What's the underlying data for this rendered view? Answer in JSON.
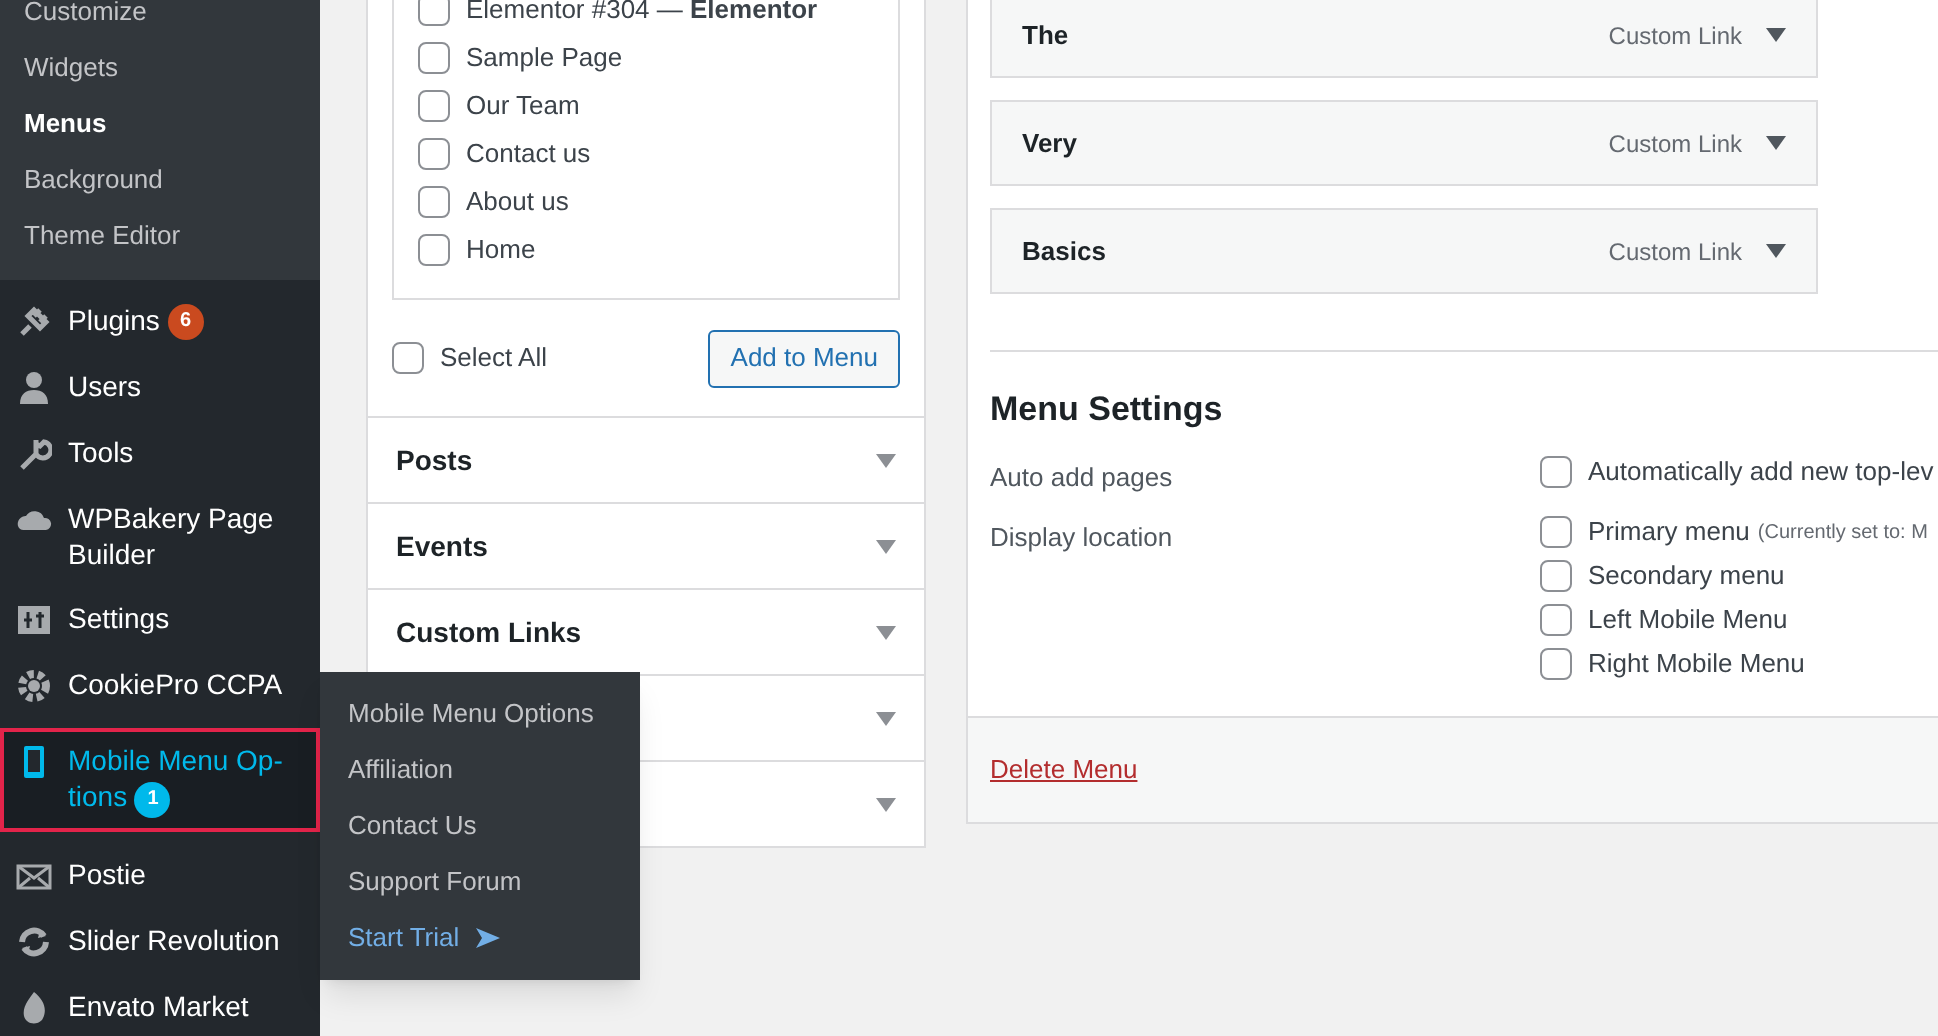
{
  "sidebar": {
    "submenu": [
      {
        "label": "Customize",
        "selected": false
      },
      {
        "label": "Widgets",
        "selected": false
      },
      {
        "label": "Menus",
        "selected": true
      },
      {
        "label": "Background",
        "selected": false
      },
      {
        "label": "Theme Editor",
        "selected": false
      }
    ],
    "items": [
      {
        "label": "Plugins",
        "badge": "6",
        "color": "#ca4a1f",
        "selected": false
      },
      {
        "label": "Users",
        "selected": false
      },
      {
        "label": "Tools",
        "selected": false
      },
      {
        "label": "WPBakery Page Builder",
        "selected": false
      },
      {
        "label": "Settings",
        "selected": false
      },
      {
        "label": "CookiePro CCPA",
        "selected": false
      },
      {
        "label": "Mobile Menu Op-tions",
        "badge": "1",
        "color": "#00b9eb",
        "selected": true
      },
      {
        "label": "Postie",
        "selected": false
      },
      {
        "label": "Slider Revolution",
        "selected": false
      },
      {
        "label": "Envato Market",
        "selected": false
      }
    ]
  },
  "flyout": {
    "items": [
      {
        "label": "Mobile Menu Options",
        "kind": "link"
      },
      {
        "label": "Affiliation",
        "kind": "link"
      },
      {
        "label": "Contact Us",
        "kind": "link"
      },
      {
        "label": "Support Forum",
        "kind": "link"
      },
      {
        "label": "Start Trial",
        "kind": "trial"
      }
    ]
  },
  "pages_box": {
    "items": [
      {
        "label": "Elementor #304 — **Elementor**",
        "checked": false
      },
      {
        "label": "Sample Page",
        "checked": false
      },
      {
        "label": "Our Team",
        "checked": false
      },
      {
        "label": "Contact us",
        "checked": false
      },
      {
        "label": "About us",
        "checked": false
      },
      {
        "label": "Home",
        "checked": false
      }
    ],
    "select_all": {
      "label": "Select All",
      "checked": false
    },
    "add_button": "Add to Menu"
  },
  "sections": [
    {
      "kind": "titled",
      "title": "Posts"
    },
    {
      "kind": "titled",
      "title": "Events"
    },
    {
      "kind": "titled",
      "title": "Custom Links"
    },
    {
      "kind": "covered"
    },
    {
      "kind": "covered"
    }
  ],
  "menu_items": [
    {
      "title": "The",
      "type": "Custom Link"
    },
    {
      "title": "Very",
      "type": "Custom Link"
    },
    {
      "title": "Basics",
      "type": "Custom Link"
    }
  ],
  "menu_settings": {
    "heading": "Menu Settings",
    "rows": [
      {
        "label": "Auto add pages",
        "options": [
          {
            "label": "Automatically add new top-lev",
            "checked": false
          }
        ]
      },
      {
        "label": "Display location",
        "options": [
          {
            "label": "Primary menu",
            "note": "(Currently set to: M",
            "checked": false
          },
          {
            "label": "Secondary menu",
            "checked": false
          },
          {
            "label": "Left Mobile Menu",
            "checked": false
          },
          {
            "label": "Right Mobile Menu",
            "checked": false
          }
        ]
      }
    ]
  },
  "delete_link": "Delete Menu"
}
